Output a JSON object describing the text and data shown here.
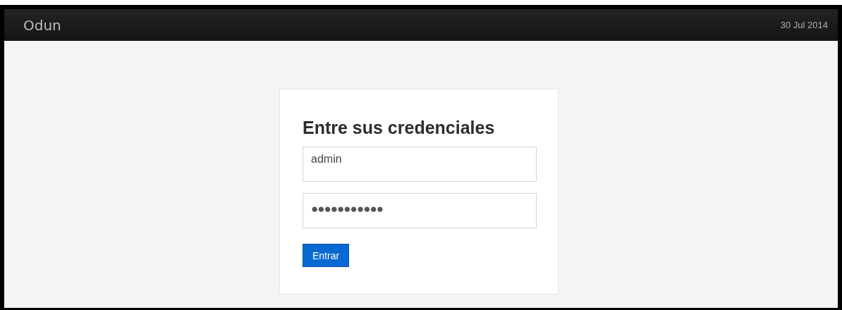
{
  "header": {
    "brand": "Odun",
    "date": "30 Jul 2014"
  },
  "login": {
    "title": "Entre sus credenciales",
    "fields": [
      {
        "kind": "text",
        "value": "admin"
      },
      {
        "kind": "password",
        "value": "●●●●●●●●●●●"
      }
    ],
    "button": "Entrar"
  }
}
